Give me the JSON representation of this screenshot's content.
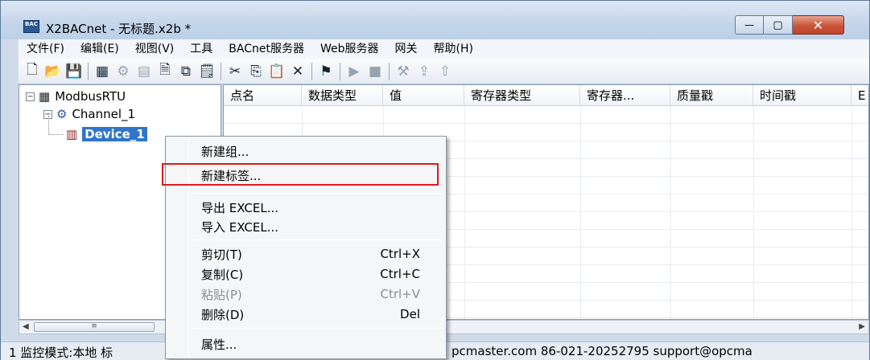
{
  "window": {
    "title": "X2BACnet - 无标题.x2b *",
    "app_icon_text": "BAC",
    "min_label": "—",
    "max_label": "▢",
    "close_label": "✕"
  },
  "menu": [
    "文件(F)",
    "编辑(E)",
    "视图(V)",
    "工具",
    "BACnet服务器",
    "Web服务器",
    "网关",
    "帮助(H)"
  ],
  "toolbar": {
    "icons": [
      {
        "name": "new-file-icon",
        "glyph": "🗋",
        "enabled": true
      },
      {
        "name": "open-folder-icon",
        "glyph": "📂",
        "enabled": true
      },
      {
        "name": "save-icon",
        "glyph": "💾",
        "enabled": true
      },
      {
        "name": "sep",
        "glyph": "",
        "enabled": true
      },
      {
        "name": "add-channel-icon",
        "glyph": "▦",
        "enabled": true
      },
      {
        "name": "add-device-icon",
        "glyph": "⚙",
        "enabled": false
      },
      {
        "name": "add-group-icon",
        "glyph": "▤",
        "enabled": false
      },
      {
        "name": "new-tag-icon",
        "glyph": "🗎",
        "enabled": true
      },
      {
        "name": "batch-tag-icon",
        "glyph": "⧉",
        "enabled": true
      },
      {
        "name": "properties-icon",
        "glyph": "🗒",
        "enabled": true
      },
      {
        "name": "sep",
        "glyph": "",
        "enabled": true
      },
      {
        "name": "cut-icon",
        "glyph": "✂",
        "enabled": true
      },
      {
        "name": "copy-icon",
        "glyph": "⎘",
        "enabled": true
      },
      {
        "name": "paste-icon",
        "glyph": "📋",
        "enabled": true
      },
      {
        "name": "delete-icon",
        "glyph": "✕",
        "enabled": true
      },
      {
        "name": "sep",
        "glyph": "",
        "enabled": true
      },
      {
        "name": "monitor-icon",
        "glyph": "⚑",
        "enabled": true
      },
      {
        "name": "sep",
        "glyph": "",
        "enabled": true
      },
      {
        "name": "run-icon",
        "glyph": "▶",
        "enabled": false
      },
      {
        "name": "stop-icon",
        "glyph": "■",
        "enabled": false
      },
      {
        "name": "sep",
        "glyph": "",
        "enabled": true
      },
      {
        "name": "tools-icon",
        "glyph": "⚒",
        "enabled": false
      },
      {
        "name": "load-icon",
        "glyph": "⇪",
        "enabled": false
      },
      {
        "name": "upload-icon",
        "glyph": "⇧",
        "enabled": false
      }
    ]
  },
  "tree": {
    "root": "ModbusRTU",
    "channel": "Channel_1",
    "device": "Device_1"
  },
  "grid": {
    "columns": [
      "点名",
      "数据类型",
      "值",
      "寄存器类型",
      "寄存器...",
      "质量戳",
      "时间戳",
      "E"
    ]
  },
  "context_menu": {
    "items": [
      {
        "label": "新建组...",
        "shortcut": "",
        "disabled": false
      },
      {
        "label": "新建标签...",
        "shortcut": "",
        "disabled": false
      },
      {
        "label": "导出 EXCEL...",
        "shortcut": "",
        "disabled": false
      },
      {
        "label": "导入 EXCEL...",
        "shortcut": "",
        "disabled": false
      },
      {
        "label": "剪切(T)",
        "shortcut": "Ctrl+X",
        "disabled": false
      },
      {
        "label": "复制(C)",
        "shortcut": "Ctrl+C",
        "disabled": false
      },
      {
        "label": "粘贴(P)",
        "shortcut": "Ctrl+V",
        "disabled": true
      },
      {
        "label": "删除(D)",
        "shortcut": "Del",
        "disabled": false
      },
      {
        "label": "属性...",
        "shortcut": "",
        "disabled": false
      }
    ]
  },
  "statusbar": {
    "left": "1 监控模式:本地  标",
    "right": "pcmaster.com 86-021-20252795 support@opcma"
  },
  "colors": {
    "highlight_box": "#e0191e",
    "selection": "#3075c9"
  }
}
